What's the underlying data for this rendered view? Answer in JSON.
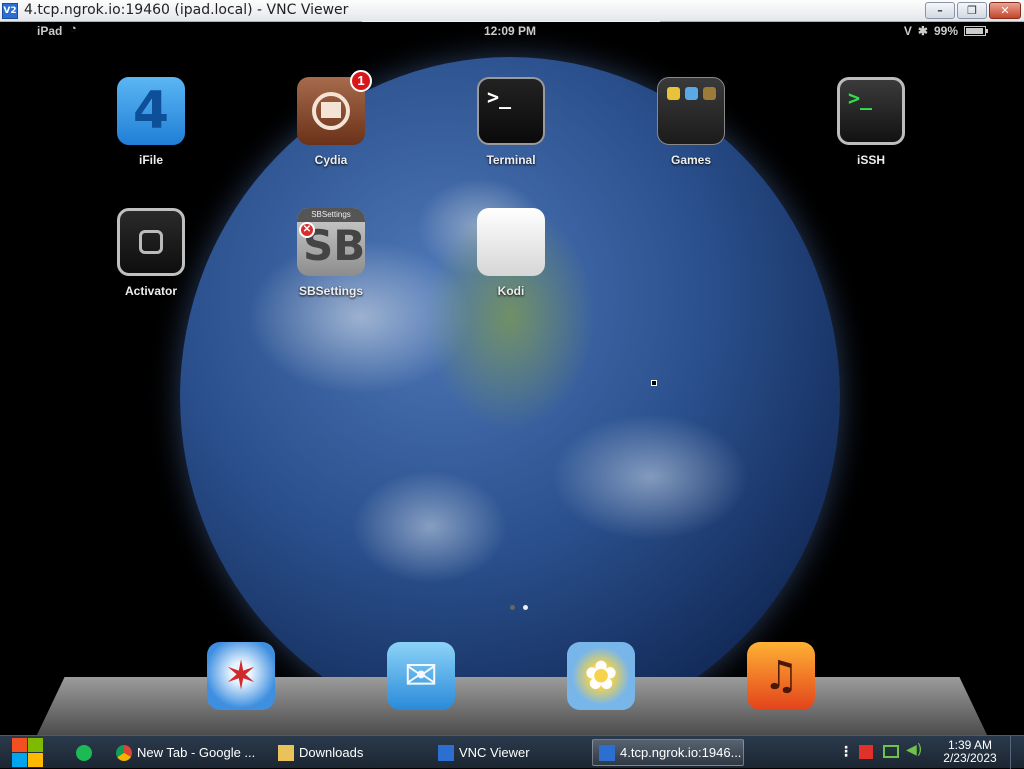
{
  "window": {
    "title": "4.tcp.ngrok.io:19460 (ipad.local) - VNC Viewer",
    "app_icon": "V2",
    "buttons": {
      "minimize": "–",
      "maximize": "❐",
      "close": "✕"
    }
  },
  "ipad": {
    "status": {
      "device": "iPad",
      "time": "12:09 PM",
      "battery": "99%"
    },
    "apps": [
      {
        "label": "iFile",
        "icon": "ifile-icon"
      },
      {
        "label": "Cydia",
        "icon": "cydia-icon",
        "badge": "1"
      },
      {
        "label": "Terminal",
        "icon": "terminal-icon",
        "glyph": ">_"
      },
      {
        "label": "Games",
        "icon": "games-folder-icon"
      },
      {
        "label": "iSSH",
        "icon": "issh-icon",
        "glyph": ">_"
      },
      {
        "label": "Activator",
        "icon": "activator-icon"
      },
      {
        "label": "SBSettings",
        "icon": "sbsettings-icon",
        "badge_text": "SBSettings",
        "glyph": "SB"
      },
      {
        "label": "Kodi",
        "icon": "kodi-icon"
      }
    ],
    "page_count": 2,
    "current_page": 2,
    "dock": [
      {
        "name": "Safari",
        "icon": "safari-icon"
      },
      {
        "name": "Mail",
        "icon": "mail-icon"
      },
      {
        "name": "Photos",
        "icon": "photos-icon"
      },
      {
        "name": "Music",
        "icon": "music-icon"
      }
    ]
  },
  "taskbar": {
    "tasks": [
      {
        "label": "New Tab - Google ...",
        "icon": "chrome-icon"
      },
      {
        "label": "Downloads",
        "icon": "folder-icon"
      },
      {
        "label": "VNC Viewer",
        "icon": "vnc-icon"
      },
      {
        "label": "4.tcp.ngrok.io:1946...",
        "icon": "vnc-icon",
        "active": true
      }
    ],
    "clock": {
      "time": "1:39 AM",
      "date": "2/23/2023"
    }
  },
  "colors": {
    "badge_red": "#d8171b",
    "taskbar_bg": "#1c2632",
    "issh_green": "#2fe04a"
  }
}
